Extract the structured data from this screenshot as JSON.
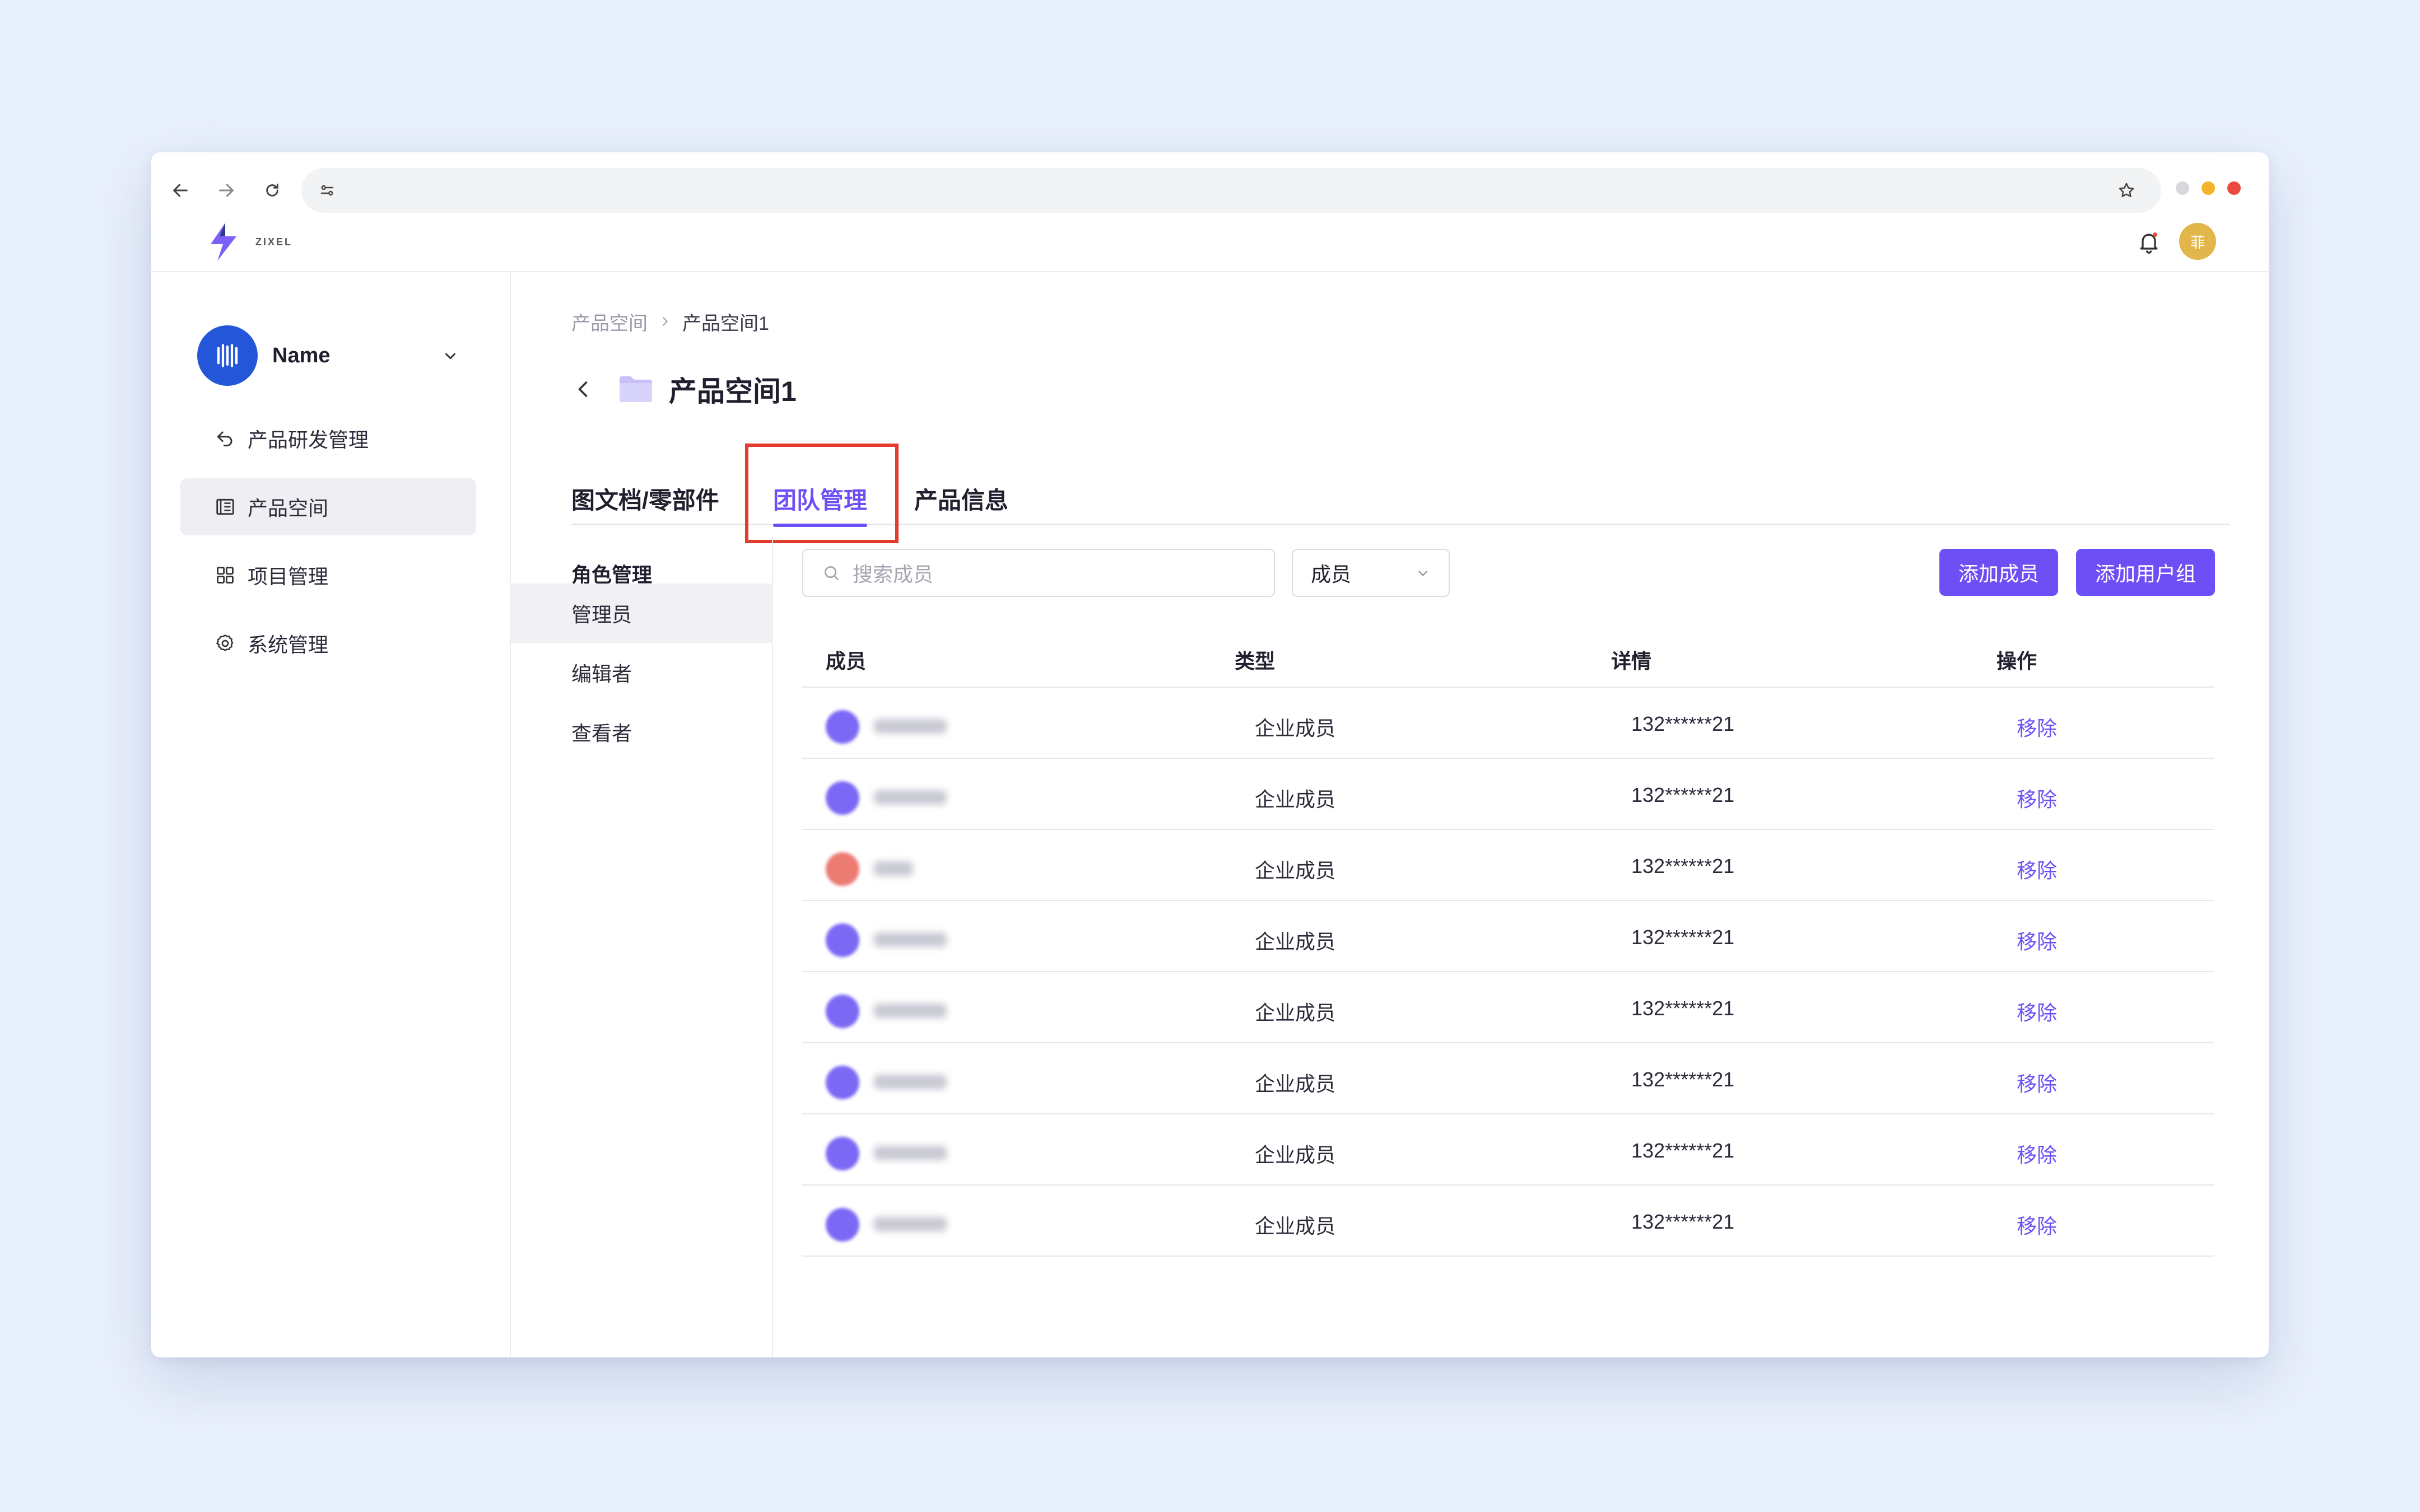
{
  "browser": {
    "traffic_colors": [
      "#d8d8dc",
      "#f3b42a",
      "#ea4b40"
    ]
  },
  "app": {
    "logo_text": "ZIXEL",
    "avatar_initial": "菲"
  },
  "sidebar": {
    "workspace_name": "Name",
    "items": [
      {
        "label": "产品研发管理",
        "icon": "back-arrow-icon"
      },
      {
        "label": "产品空间",
        "icon": "space-icon",
        "active": true
      },
      {
        "label": "项目管理",
        "icon": "grid-icon"
      },
      {
        "label": "系统管理",
        "icon": "gear-icon"
      }
    ]
  },
  "breadcrumb": {
    "root": "产品空间",
    "current": "产品空间1"
  },
  "page": {
    "title": "产品空间1"
  },
  "tabs": [
    {
      "label": "图文档/零部件"
    },
    {
      "label": "团队管理",
      "active": true
    },
    {
      "label": "产品信息"
    }
  ],
  "roles": {
    "heading": "角色管理",
    "items": [
      "管理员",
      "编辑者",
      "查看者"
    ],
    "active": "管理员"
  },
  "toolbar": {
    "search_placeholder": "搜索成员",
    "filter_value": "成员",
    "add_member": "添加成员",
    "add_group": "添加用户组"
  },
  "table": {
    "columns": [
      "成员",
      "类型",
      "详情",
      "操作"
    ],
    "rows": [
      {
        "type": "企业成员",
        "detail": "132******21",
        "action": "移除",
        "avatar_color": "#7b68f5"
      },
      {
        "type": "企业成员",
        "detail": "132******21",
        "action": "移除",
        "avatar_color": "#7b68f5"
      },
      {
        "type": "企业成员",
        "detail": "132******21",
        "action": "移除",
        "avatar_color": "#ec7b72"
      },
      {
        "type": "企业成员",
        "detail": "132******21",
        "action": "移除",
        "avatar_color": "#7b68f5"
      },
      {
        "type": "企业成员",
        "detail": "132******21",
        "action": "移除",
        "avatar_color": "#7b68f5"
      },
      {
        "type": "企业成员",
        "detail": "132******21",
        "action": "移除",
        "avatar_color": "#7b68f5"
      },
      {
        "type": "企业成员",
        "detail": "132******21",
        "action": "移除",
        "avatar_color": "#7b68f5"
      },
      {
        "type": "企业成员",
        "detail": "132******21",
        "action": "移除",
        "avatar_color": "#7b68f5"
      }
    ]
  },
  "colors": {
    "accent": "#6e4ff6",
    "highlight_box": "#e53a2e",
    "workspace_logo": "#2356d9",
    "page_background": "#e9f0fd"
  }
}
